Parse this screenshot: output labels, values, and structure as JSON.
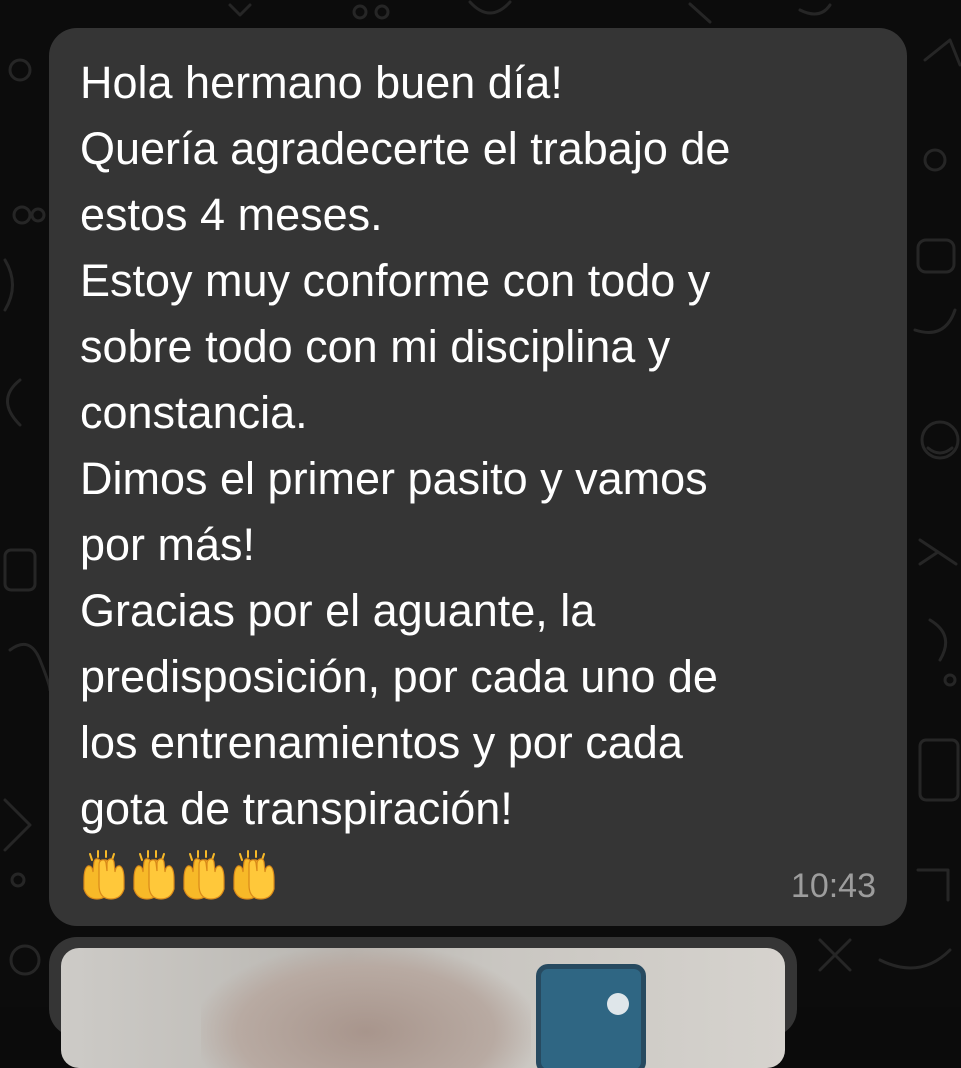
{
  "message": {
    "lines": [
      "Hola hermano buen día!",
      "Quería agradecerte el trabajo de",
      "estos 4 meses.",
      "Estoy muy conforme con todo y",
      "sobre todo con mi disciplina y",
      "constancia.",
      "Dimos el primer pasito y vamos",
      "por más!",
      "Gracias por el aguante, la",
      "predisposición, por cada uno de",
      "los entrenamientos y por cada",
      "gota de transpiración!"
    ],
    "emoji": "🙌🙌🙌🙌",
    "emoji_icons": [
      "raising-hands-icon",
      "raising-hands-icon",
      "raising-hands-icon",
      "raising-hands-icon"
    ],
    "time": "10:43"
  },
  "colors": {
    "background": "#0c0c0c",
    "bubble": "#353535",
    "text": "#ffffff",
    "timestamp": "#9d9d9d",
    "emoji": "#f7b928"
  },
  "media_preview": {
    "icon": "photo-thumbnail"
  }
}
